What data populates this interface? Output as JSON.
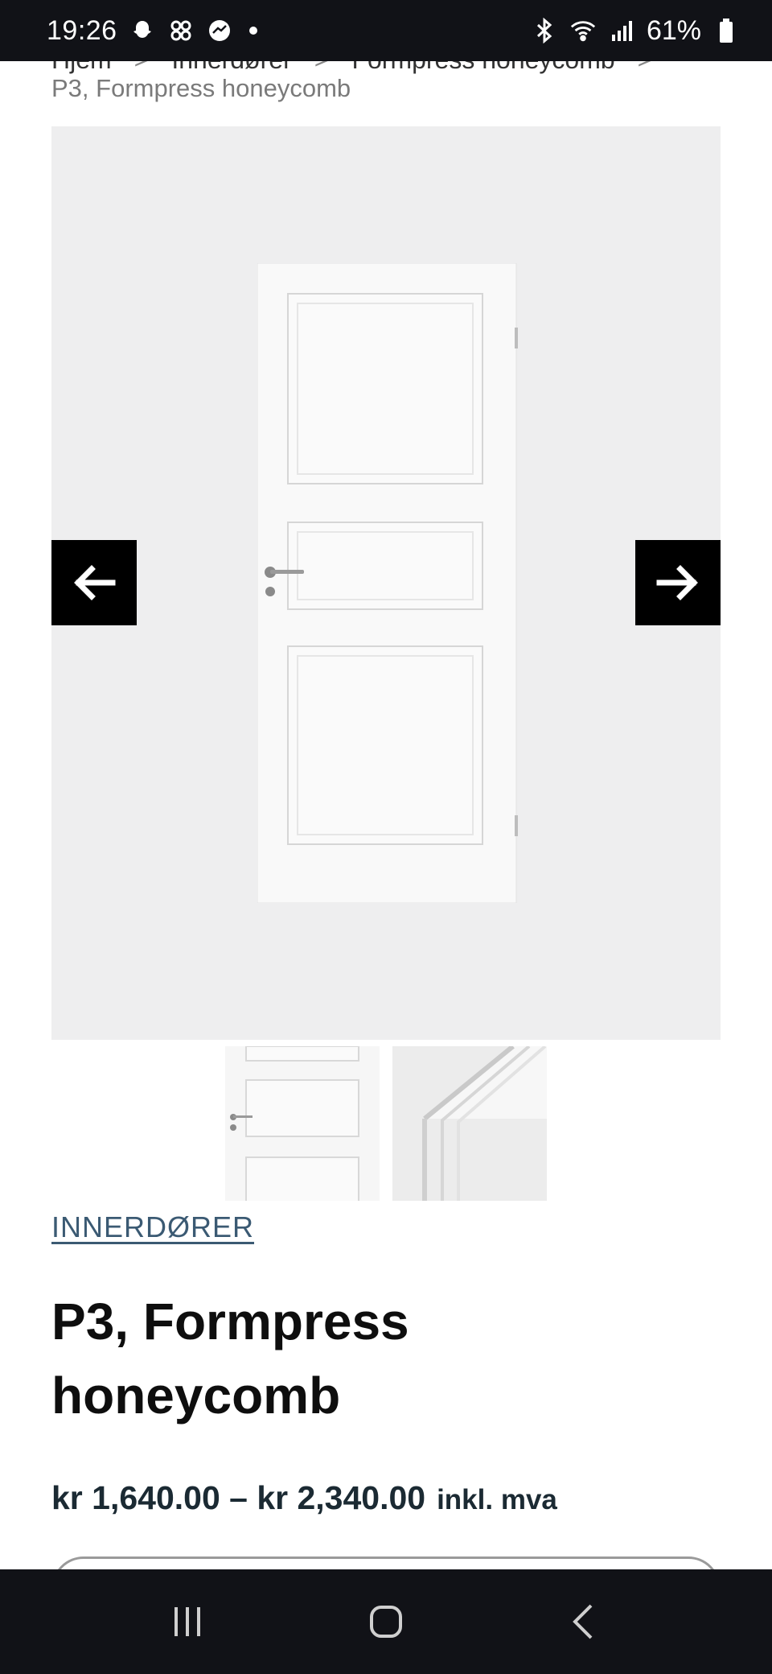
{
  "status_bar": {
    "time": "19:26",
    "battery": "61%",
    "left_icons": [
      "snapchat-icon",
      "pinwheel-icon",
      "messenger-icon",
      "dot-icon"
    ],
    "right_icons": [
      "bluetooth-icon",
      "wifi-icon",
      "signal-icon",
      "battery-icon"
    ]
  },
  "breadcrumb": {
    "items": [
      "Hjem",
      "Innerdører",
      "Formpress honeycomb"
    ],
    "separator": ">",
    "current": "P3, Formpress honeycomb"
  },
  "gallery": {
    "prev_icon": "arrow-left-icon",
    "next_icon": "arrow-right-icon",
    "background": "#eeeeef"
  },
  "product": {
    "category": "INNERDØRER",
    "title_line1": "P3, Formpress",
    "title_line2": "honeycomb",
    "price_range": "kr 1,640.00 – kr 2,340.00",
    "price_suffix": "inkl. mva"
  },
  "colors": {
    "accent_link": "#3b5a73",
    "price": "#1b2a33",
    "bar": "#111217"
  },
  "nav_bar": {
    "icons": [
      "recent-apps-icon",
      "home-icon",
      "back-icon"
    ]
  }
}
